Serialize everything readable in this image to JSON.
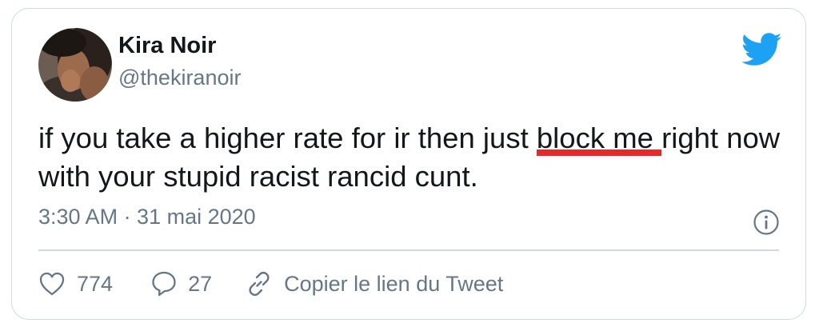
{
  "tweet": {
    "author": {
      "name": "Kira Noir",
      "handle": "@thekiranoir",
      "avatar_icon": "profile-photo"
    },
    "text_before": "if you take a higher rate for ir then just ",
    "text_highlight": "block me",
    "text_after": " right now with your stupid racist rancid cunt.",
    "timestamp": "3:30 AM · 31 mai 2020",
    "likes": "774",
    "replies": "27",
    "copy_link_label": "Copier le lien du Tweet"
  },
  "icons": {
    "brand": "twitter-bird-icon",
    "info": "info-icon",
    "like": "heart-icon",
    "reply": "speech-bubble-icon",
    "link": "link-icon"
  },
  "colors": {
    "brand_blue": "#1da1f2",
    "highlight_underline": "#e8272b",
    "secondary_text": "#657786",
    "primary_text": "#14171a",
    "border": "#cfd9de"
  }
}
